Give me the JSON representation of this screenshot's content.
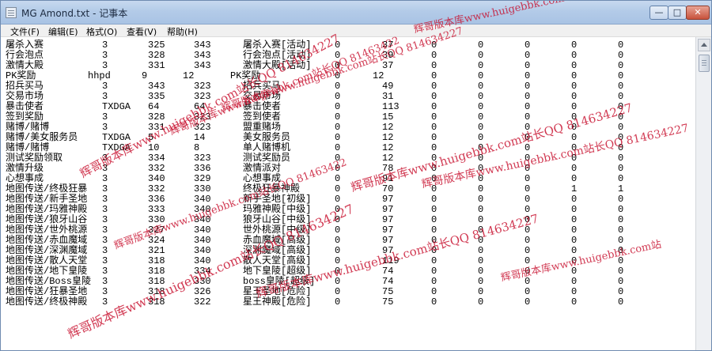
{
  "window": {
    "title": "MG Amond.txt - 记事本",
    "min_glyph": "—",
    "max_glyph": "□",
    "close_glyph": "✕"
  },
  "menu": [
    "文件(F)",
    "编辑(E)",
    "格式(O)",
    "查看(V)",
    "帮助(H)"
  ],
  "lines": [
    [
      "屠杀入赛",
      "3",
      "325",
      "343",
      "屠杀入赛[活动]",
      "0",
      "37",
      "0",
      "0",
      "0",
      "0",
      "0"
    ],
    [
      "行会泡点",
      "3",
      "328",
      "343",
      "行会泡点[活动]",
      "0",
      "39",
      "0",
      "0",
      "0",
      "0",
      "0"
    ],
    [
      "激情大殿",
      "3",
      "331",
      "343",
      "激情大殿[活动]",
      "0",
      "37",
      "0",
      "0",
      "0",
      "0",
      "0"
    ],
    [
      "PK奖励",
      "hhpd",
      "9",
      "12",
      "PK奖励",
      "0",
      "12",
      "0",
      "0",
      "0",
      "0",
      "0"
    ],
    [
      "招兵买马",
      "3",
      "343",
      "323",
      "招兵买马",
      "0",
      "49",
      "0",
      "0",
      "0",
      "0",
      "0"
    ],
    [
      "交易市场",
      "3",
      "335",
      "323",
      "交易市场",
      "0",
      "31",
      "0",
      "0",
      "0",
      "0",
      "0"
    ],
    [
      "暴击使者",
      "TXDGA",
      "64",
      "64",
      "暴击使者",
      "0",
      "113",
      "0",
      "0",
      "0",
      "0",
      "0"
    ],
    [
      "签到奖励",
      "3",
      "328",
      "323",
      "签到使者",
      "0",
      "15",
      "0",
      "0",
      "0",
      "0",
      "0"
    ],
    [
      "赌博/赌博",
      "3",
      "331",
      "323",
      "盟重赌场",
      "0",
      "12",
      "0",
      "0",
      "0",
      "0",
      "0"
    ],
    [
      "赌博/美女服务员",
      "TXDGA",
      "5",
      "14",
      "美女服务员",
      "0",
      "12",
      "0",
      "0",
      "0",
      "0",
      "0"
    ],
    [
      " 赌博/赌博",
      "TXDGA",
      "10",
      "8",
      "单人赌博机",
      "0",
      "12",
      "0",
      "0",
      "0",
      "0",
      "0"
    ],
    [
      "测试奖励领取",
      "3",
      "334",
      "323",
      "测试奖励员",
      "0",
      "12",
      "0",
      "0",
      "0",
      "0",
      "0"
    ],
    [
      "激情升级",
      "3",
      "332",
      "336",
      "激情派对",
      "0",
      "78",
      "0",
      "0",
      "0",
      "0",
      "0"
    ],
    [
      "心想事成",
      "3",
      "340",
      "329",
      "心想事成",
      "0",
      "91",
      "0",
      "0",
      "0",
      "0",
      "0"
    ],
    [
      "地图传送/终极狂暴",
      "3",
      "332",
      "330",
      "终极狂暴神殿",
      "0",
      "70",
      "0",
      "0",
      "0",
      "1",
      "1"
    ],
    [
      "地图传送/新手圣地",
      "3",
      "336",
      "340",
      "新手圣地[初级]",
      "0",
      "97",
      "0",
      "0",
      "0",
      "0",
      "0"
    ],
    [
      "地图传送/玛雅神殿",
      "3",
      "333",
      "340",
      "玛雅神殿[中级]",
      "0",
      "97",
      "0",
      "0",
      "0",
      "0",
      "0"
    ],
    [
      "地图传送/狼牙山谷",
      "3",
      "330",
      "340",
      "狼牙山谷[中级]",
      "0",
      "97",
      "0",
      "0",
      "0",
      "0",
      "0"
    ],
    [
      "地图传送/世外桃源",
      "3",
      "327",
      "340",
      "世外桃源[中级]",
      "0",
      "97",
      "0",
      "0",
      "0",
      "0",
      "0"
    ],
    [
      "地图传送/赤血魔域",
      "3",
      "324",
      "340",
      "赤血魔域[高级]",
      "0",
      "97",
      "0",
      "0",
      "0",
      "0",
      "0"
    ],
    [
      "地图传送/深渊魔域",
      "3",
      "321",
      "340",
      "深渊魔域[高级]",
      "0",
      "97",
      "0",
      "0",
      "0",
      "0",
      "0"
    ],
    [
      "地图传送/散人天堂",
      "3",
      "318",
      "340",
      "散人天堂[高级]",
      "0",
      "119",
      "0",
      "0",
      "0",
      "0",
      "0"
    ],
    [
      "地图传送/地下皇陵",
      "3",
      "318",
      "334",
      "地下皇陵[超级]",
      "0",
      "74",
      "0",
      "0",
      "0",
      "0",
      "0"
    ],
    [
      "地图传送/Boss皇陵",
      "3",
      "318",
      "330",
      "boss皇陵[超级]",
      "0",
      "74",
      "0",
      "0",
      "0",
      "0",
      "0"
    ],
    [
      "地图传送/狂暴圣地",
      "3",
      "318",
      "326",
      "星王圣地[危险]",
      "0",
      "75",
      "0",
      "0",
      "0",
      "0",
      "0"
    ],
    [
      "地图传送/终极神殿",
      "3",
      "318",
      "322",
      "星王神殿[危险]",
      "0",
      "75",
      "0",
      "0",
      "0",
      "0",
      "0"
    ]
  ],
  "watermarks": [
    "辉哥版本库www.huigebbk.com站长QQ 81463422",
    "辉哥版本库www.huigebbk.com站长QQ 814634227",
    "辉哥版本库www.huigebbk.com站长QQ 81463422",
    "辉哥版本库www.huigebbk.com站长QQ 814634227",
    "辉哥版本库www.huigebbk.com站长QQ 814634227",
    "辉哥版本库www.huigebbk.com站长QQ 814634227",
    "辉哥版本库www.huigebbk.com站",
    "辉哥版本库www.huigebbk.com站长QQ 814634227",
    "辉哥版本库www.huigebbk.com站长QQ 81463422",
    "辉哥版本库www.huigebbk.com站长QQ 814634227"
  ],
  "colors": {
    "watermark": "#c8102e",
    "titlebar": "#b3cbe8",
    "close": "#c8523c"
  }
}
